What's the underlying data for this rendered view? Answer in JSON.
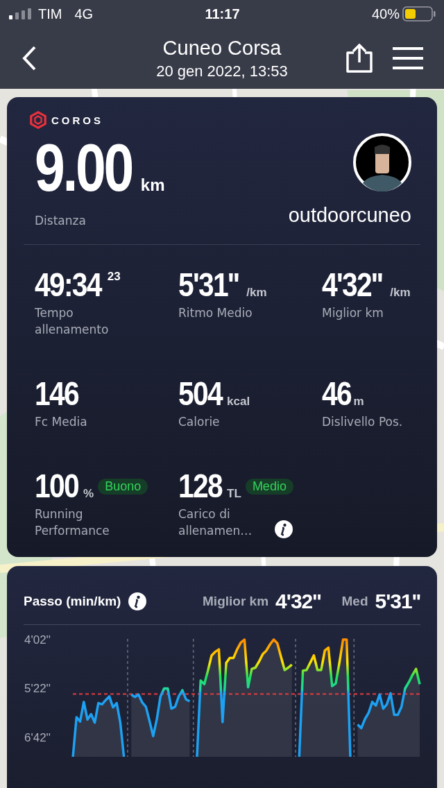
{
  "status_bar": {
    "carrier": "TIM",
    "network": "4G",
    "time": "11:17",
    "battery": "40%"
  },
  "header": {
    "title": "Cuneo Corsa",
    "subtitle": "20 gen 2022, 13:53"
  },
  "summary": {
    "brand": "COROS",
    "distance": {
      "value": "9.00",
      "unit": "km",
      "label": "Distanza"
    },
    "user": "outdoorcuneo"
  },
  "stats": [
    {
      "value": "49:34",
      "sup": "23",
      "label": "Tempo allenamento"
    },
    {
      "value": "5'31''",
      "unit": "/km",
      "label": "Ritmo Medio"
    },
    {
      "value": "4'32''",
      "unit": "/km",
      "label": "Miglior km"
    },
    {
      "value": "146",
      "label": "Fc Media"
    },
    {
      "value": "504",
      "unit": "kcal",
      "label": "Calorie"
    },
    {
      "value": "46",
      "unit": "m",
      "label": "Dislivello Pos."
    },
    {
      "value": "100",
      "unit": "%",
      "badge": "Buono",
      "label": "Running Performance"
    },
    {
      "value": "128",
      "unit": "TL",
      "badge": "Medio",
      "label": "Carico di allenamen…",
      "info": true
    }
  ],
  "pace": {
    "title": "Passo (min/km)",
    "best_label": "Miglior km",
    "best": "4'32''",
    "avg_label": "Med",
    "avg": "5'31''",
    "y_axis_labels": [
      "4'02''",
      "5'22''",
      "6'42''"
    ]
  }
}
